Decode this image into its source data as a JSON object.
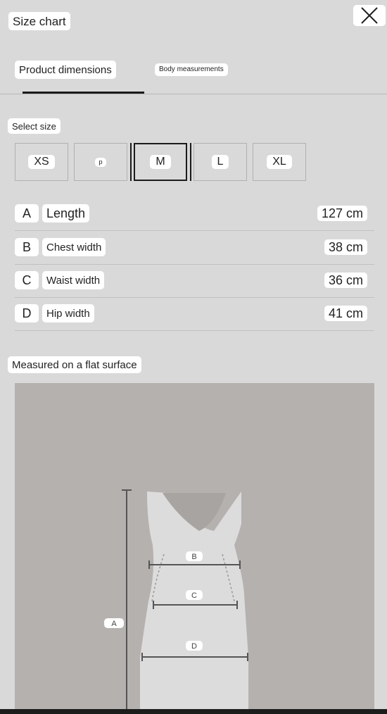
{
  "header": {
    "title": "Size chart"
  },
  "tabs": [
    {
      "label": "Product dimensions",
      "active": true
    },
    {
      "label": "Body measurements",
      "active": false
    }
  ],
  "size_selector": {
    "label": "Select size",
    "sizes": [
      "XS",
      "p",
      "M",
      "L",
      "XL"
    ],
    "selected": "M"
  },
  "measurements": [
    {
      "letter": "A",
      "name": "Length",
      "value": "127 cm"
    },
    {
      "letter": "B",
      "name": "Chest width",
      "value": "38 cm"
    },
    {
      "letter": "C",
      "name": "Waist width",
      "value": "36 cm"
    },
    {
      "letter": "D",
      "name": "Hip width",
      "value": "41 cm"
    }
  ],
  "illustration": {
    "caption": "Measured on a flat surface",
    "markers": {
      "a": "A",
      "b": "B",
      "c": "C",
      "d": "D"
    }
  },
  "icons": {
    "close": "close-icon"
  },
  "colors": {
    "background": "#d9d9d9",
    "illustration_bg": "#b5b1ae",
    "selected_border": "#1b1b1b"
  }
}
